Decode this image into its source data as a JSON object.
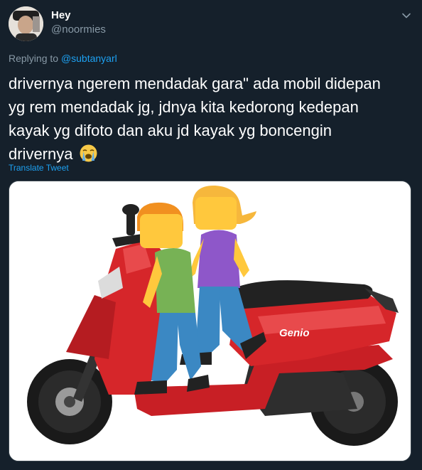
{
  "author": {
    "display_name": "Hey",
    "handle": "@noormies"
  },
  "reply": {
    "prefix": "Replying to ",
    "mention": "@subtanyarl"
  },
  "tweet": {
    "text": "drivernya ngerem mendadak gara\" ada mobil didepan\nyg rem mendadak jg, jdnya kita kedorong kedepan\nkayak yg difoto dan aku jd kayak yg boncengin\ndrivernya",
    "emoji": "loudly-crying-face"
  },
  "translate_label": "Translate Tweet",
  "media": {
    "description_icons": [
      "scooter",
      "boy-emoji",
      "woman-emoji"
    ],
    "scooter_brand_text": "Genio"
  },
  "icons": {
    "menu": "chevron-down-icon"
  },
  "colors": {
    "background": "#15202b",
    "link": "#1da1f2",
    "secondary_text": "#8899a6",
    "scooter_red": "#d6262a"
  }
}
